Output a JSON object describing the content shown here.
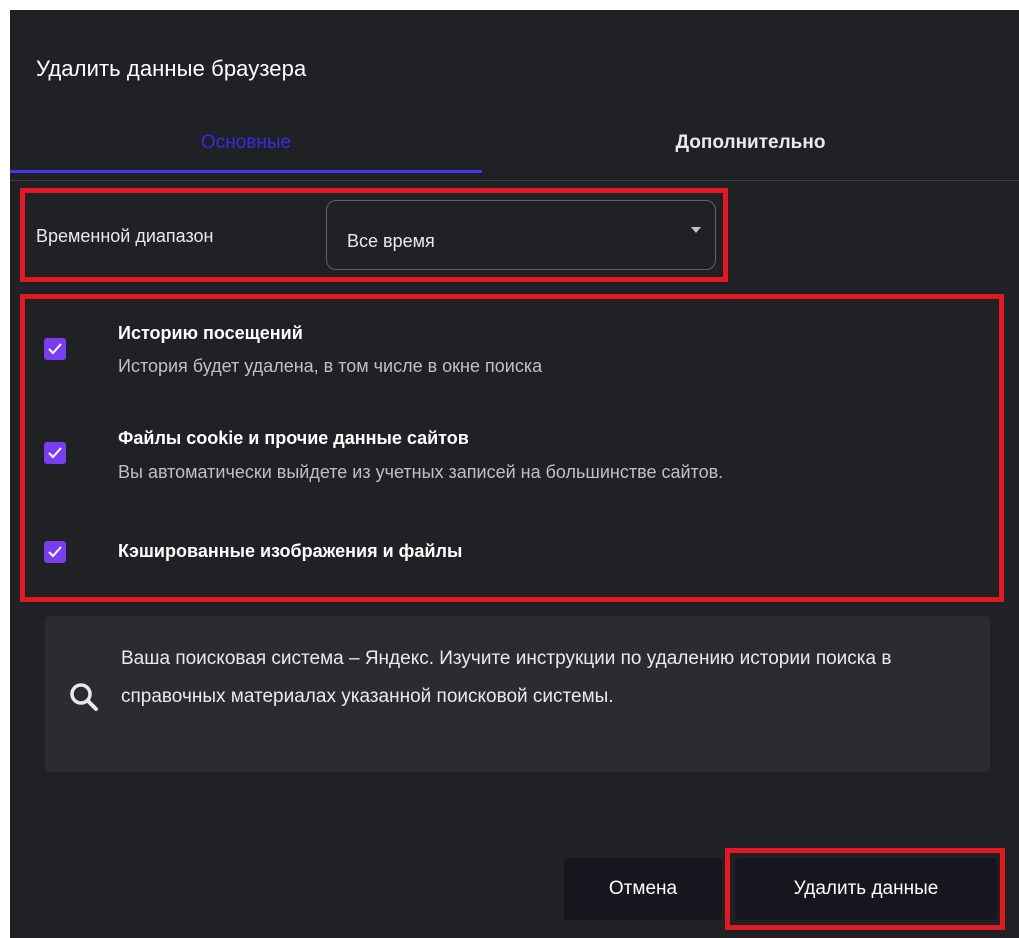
{
  "dialog": {
    "title": "Удалить данные браузера"
  },
  "tabs": [
    {
      "label": "Основные",
      "active": true
    },
    {
      "label": "Дополнительно",
      "active": false
    }
  ],
  "time_range": {
    "label": "Временной диапазон",
    "selected": "Все время"
  },
  "options": [
    {
      "title": "Историю посещений",
      "description": "История будет удалена, в том числе в окне поиска",
      "checked": true
    },
    {
      "title": "Файлы cookie и прочие данные сайтов",
      "description": "Вы автоматически выйдете из учетных записей на большинстве сайтов.",
      "checked": true
    },
    {
      "title": "Кэшированные изображения и файлы",
      "checked": true
    }
  ],
  "info": {
    "icon": "search-icon",
    "text": "Ваша поисковая система – Яндекс. Изучите инструкции по удалению истории поиска в справочных материалах указанной поисковой системы."
  },
  "buttons": {
    "cancel": "Отмена",
    "delete": "Удалить данные"
  },
  "colors": {
    "background": "#202124",
    "accent": "#4b35e8",
    "checkbox": "#7b3df0",
    "highlight": "#e21922"
  }
}
